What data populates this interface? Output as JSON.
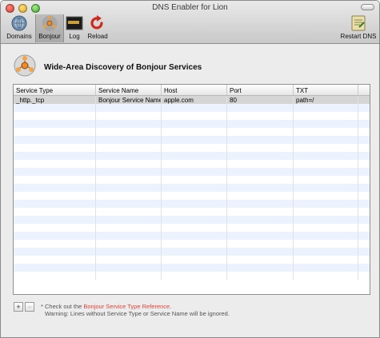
{
  "window": {
    "title": "DNS Enabler for Lion"
  },
  "toolbar": {
    "items": [
      {
        "label": "Domains",
        "icon": "network-globe-icon"
      },
      {
        "label": "Bonjour",
        "icon": "bonjour-icon",
        "selected": true
      },
      {
        "label": "Log",
        "icon": "console-log-icon"
      },
      {
        "label": "Reload",
        "icon": "reload-icon"
      }
    ],
    "restart_label": "Restart DNS",
    "restart_icon": "restart-dns-icon"
  },
  "page": {
    "title": "Wide-Area Discovery of Bonjour Services",
    "icon": "bonjour-services-icon"
  },
  "table": {
    "columns": [
      "Service Type",
      "Service Name",
      "Host",
      "Port",
      "TXT"
    ],
    "rows": [
      [
        "_http._tcp",
        "Bonjour Service Name",
        "apple.com",
        "80",
        "path=/"
      ]
    ],
    "empty_rows": 22
  },
  "footer": {
    "add_label": "+",
    "remove_label": "−",
    "note_prefix": "* Check out the ",
    "note_link": "Bonjour Service Type Reference",
    "note_suffix": ".",
    "warning": "Warning: Lines without Service Type or Service Name will be ignored."
  },
  "colors": {
    "link": "#e0443a",
    "row_stripe": "#edf3fe",
    "row_selected": "#d5d5d5"
  }
}
